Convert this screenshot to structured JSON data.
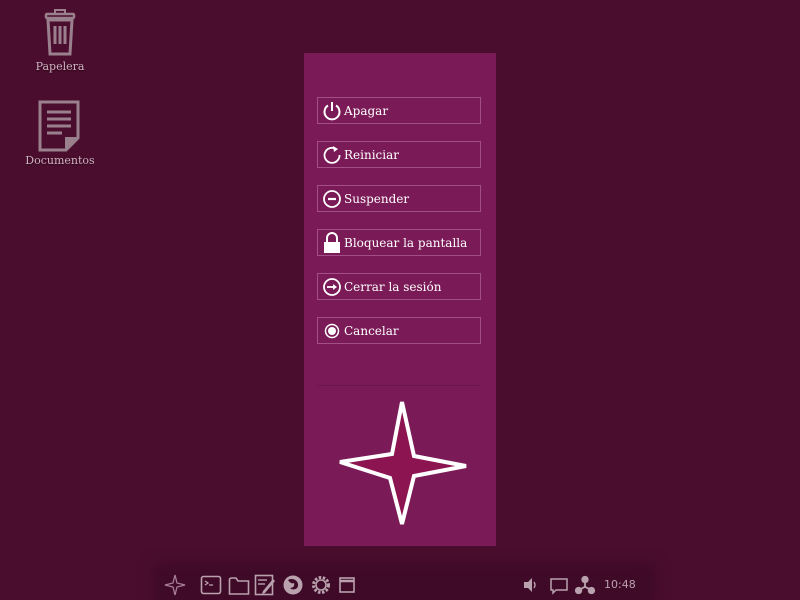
{
  "desktop": {
    "icons": [
      {
        "label": "Papelera",
        "icon": "trash-icon"
      },
      {
        "label": "Documentos",
        "icon": "document-icon"
      }
    ]
  },
  "session_menu": {
    "options": [
      {
        "label": "Apagar",
        "icon": "power-icon"
      },
      {
        "label": "Reiniciar",
        "icon": "restart-icon"
      },
      {
        "label": "Suspender",
        "icon": "suspend-icon"
      },
      {
        "label": "Bloquear la pantalla",
        "icon": "lock-icon"
      },
      {
        "label": "Cerrar la sesión",
        "icon": "logout-icon"
      },
      {
        "label": "Cancelar",
        "icon": "cancel-icon"
      }
    ],
    "colors": {
      "panel": "#7a1a57",
      "accent": "#8c1450"
    }
  },
  "taskbar": {
    "launchers": [
      "menu-star-icon",
      "terminal-icon",
      "files-icon",
      "text-editor-icon",
      "firefox-icon",
      "settings-gear-icon",
      "window-icon"
    ],
    "tray": [
      "volume-icon",
      "notification-icon",
      "network-icon"
    ],
    "clock": "10:48"
  }
}
